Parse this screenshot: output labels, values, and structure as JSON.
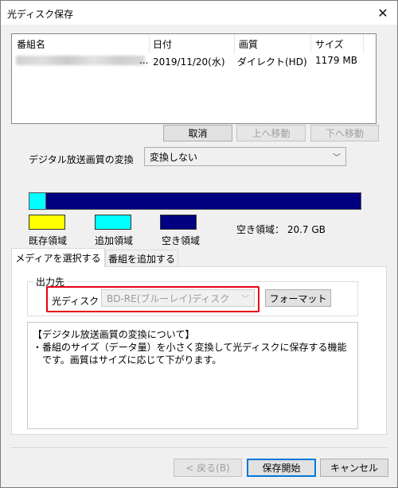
{
  "window": {
    "title": "光ディスク保存",
    "close_glyph": "✕"
  },
  "list": {
    "columns": [
      "番組名",
      "日付",
      "画質",
      "サイズ"
    ],
    "rows": [
      {
        "date": "2019/11/20(水)",
        "quality": "ダイレクト(HD)",
        "size": "1179 MB"
      }
    ],
    "name_ellipsis": "..."
  },
  "list_buttons": {
    "cancel": "取消",
    "move_up": "上へ移動",
    "move_down": "下へ移動"
  },
  "conversion": {
    "label": "デジタル放送画質の変換",
    "value": "変換しない"
  },
  "capacity": {
    "used_fraction": 0.05,
    "legend": [
      {
        "label": "既存領域",
        "color": "#ffff00"
      },
      {
        "label": "追加領域",
        "color": "#00ffff"
      },
      {
        "label": "空き領域",
        "color": "#000080"
      }
    ],
    "free_space": "空き領域： 20.7 GB"
  },
  "tabs": [
    {
      "label": "メディアを選択する",
      "active": true
    },
    {
      "label": "番組を追加する",
      "active": false
    }
  ],
  "output": {
    "group_title": "出力先",
    "disc_label": "光ディスク",
    "disc_value": "BD-RE(ブルーレイ)ディスク",
    "format_button": "フォーマット"
  },
  "info": {
    "lines": [
      "【デジタル放送画質の変換について】",
      "・番組のサイズ（データ量）を小さく変換して光ディスクに保存する機能",
      "　です。画質はサイズに応じて下がります。"
    ]
  },
  "footer": {
    "back": "< 戻る(B)",
    "start": "保存開始",
    "cancel": "キャンセル"
  },
  "icons": {
    "close": "close-icon",
    "combo_arrow": "chevron-down-icon"
  }
}
